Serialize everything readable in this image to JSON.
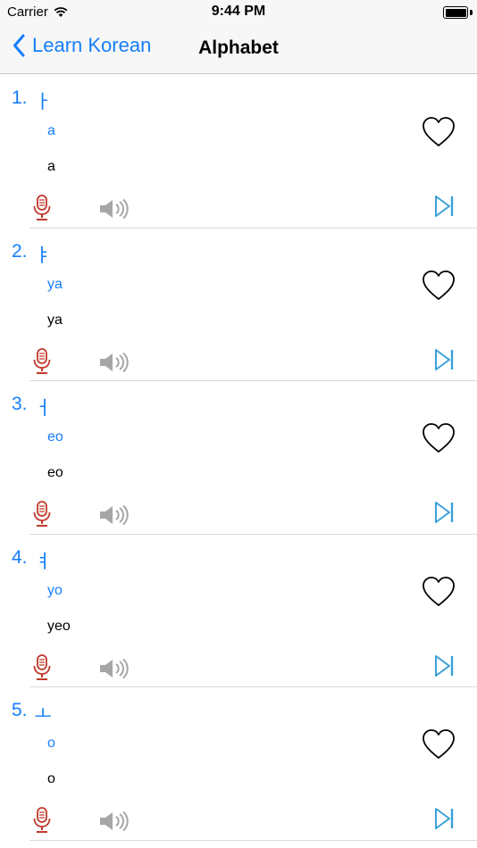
{
  "status_bar": {
    "carrier": "Carrier",
    "time": "9:44 PM"
  },
  "nav": {
    "back_label": "Learn Korean",
    "title": "Alphabet"
  },
  "colors": {
    "accent": "#157efb",
    "mic": "#c0392b",
    "speaker": "#a6a6a6"
  },
  "items": [
    {
      "number": "1.",
      "letter": "ㅏ",
      "romanization": "a",
      "pronunciation": "a"
    },
    {
      "number": "2.",
      "letter": "ㅑ",
      "romanization": "ya",
      "pronunciation": "ya"
    },
    {
      "number": "3.",
      "letter": "ㅓ",
      "romanization": "eo",
      "pronunciation": "eo"
    },
    {
      "number": "4.",
      "letter": "ㅕ",
      "romanization": "yo",
      "pronunciation": "yeo"
    },
    {
      "number": "5.",
      "letter": "ㅗ",
      "romanization": "o",
      "pronunciation": "o"
    }
  ]
}
